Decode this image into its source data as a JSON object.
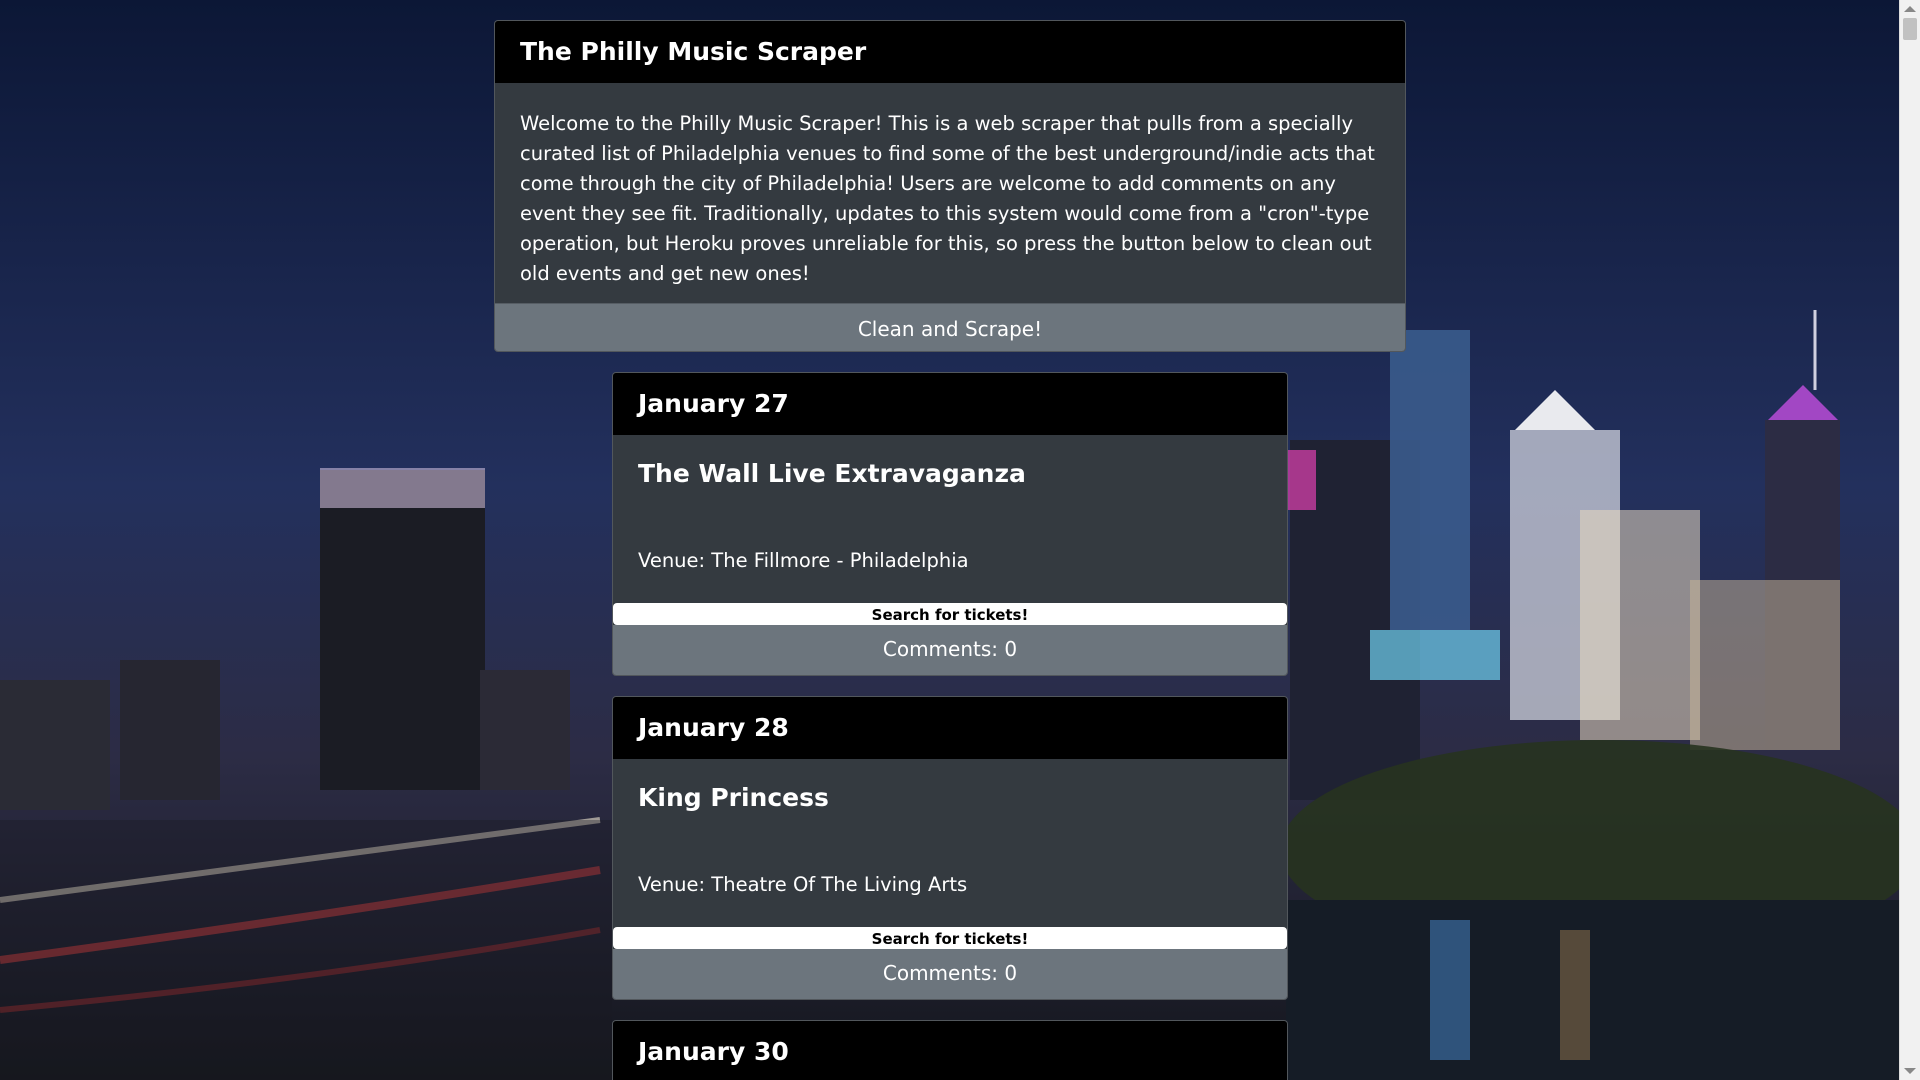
{
  "intro": {
    "title": "The Philly Music Scraper",
    "body": "Welcome to the Philly Music Scraper! This is a web scraper that pulls from a specially curated list of Philadelphia venues to find some of the best underground/indie acts that come through the city of Philadelphia! Users are welcome to add comments on any event they see fit. Traditionally, updates to this system would come from a \"cron\"-type operation, but Heroku proves unreliable for this, so press the button below to clean out old events and get new ones!",
    "button_label": "Clean and Scrape!"
  },
  "events": [
    {
      "date": "January 27",
      "title": "The Wall Live Extravaganza",
      "venue": "Venue: The Fillmore - Philadelphia",
      "tickets_label": "Search for tickets!",
      "comments": "Comments: 0"
    },
    {
      "date": "January 28",
      "title": "King Princess",
      "venue": "Venue: Theatre Of The Living Arts",
      "tickets_label": "Search for tickets!",
      "comments": "Comments: 0"
    },
    {
      "date": "January 30"
    }
  ],
  "colors": {
    "card_bg": "#343a40",
    "header_bg": "#000000",
    "button_bg": "#6c757d"
  }
}
